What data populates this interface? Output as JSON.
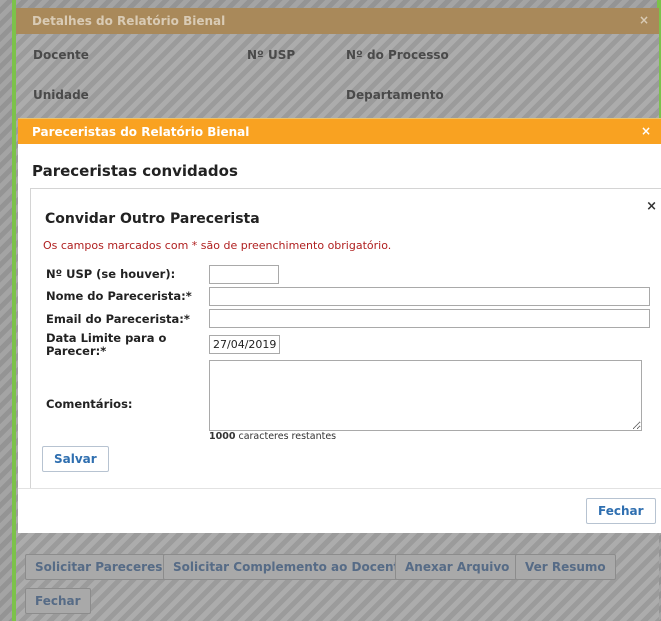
{
  "background_dialog": {
    "title": "Detalhes do Relatório Bienal",
    "close": "×",
    "fields": {
      "docente": "Docente",
      "nusp": "Nº USP",
      "processo": "Nº do Processo",
      "unidade": "Unidade",
      "departamento": "Departamento"
    },
    "buttons": {
      "solicitar_pareceres": "Solicitar Pareceres",
      "solicitar_complemento": "Solicitar Complemento ao Docente",
      "anexar_arquivo": "Anexar Arquivo",
      "ver_resumo": "Ver Resumo",
      "fechar": "Fechar"
    }
  },
  "pareceristas_dialog": {
    "title": "Pareceristas do Relatório Bienal",
    "close": "×",
    "heading": "Pareceristas convidados",
    "close_button": "Fechar"
  },
  "convidar_dialog": {
    "close": "×",
    "title": "Convidar Outro Parecerista",
    "required_note": "Os campos marcados com * são de preenchimento obrigatório.",
    "fields": {
      "nusp_label": "Nº USP (se houver):",
      "nusp_value": "",
      "nome_label": "Nome do Parecerista:*",
      "nome_value": "",
      "email_label": "Email do Parecerista:*",
      "email_value": "",
      "data_label": "Data Limite para o Parecer:*",
      "data_value": "27/04/2019",
      "comentarios_label": "Comentários:",
      "comentarios_value": ""
    },
    "char_count_number": "1000",
    "char_count_text": " caracteres restantes",
    "save_button": "Salvar"
  },
  "colors": {
    "orange_header": "#f9a221",
    "dim_header": "#a9895a",
    "button_text": "#2f6fb0",
    "required_note": "#b02020",
    "green_edge": "#7cc24a"
  }
}
